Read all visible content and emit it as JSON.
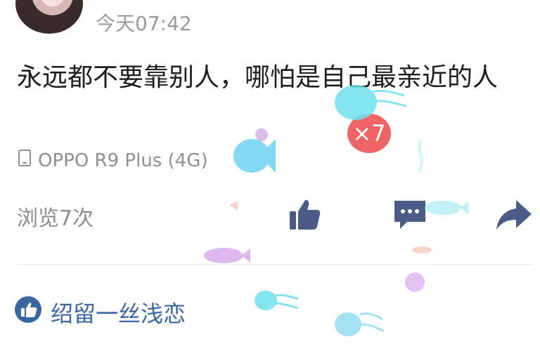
{
  "post": {
    "timestamp": "今天07:42",
    "text": "永远都不要靠别人，哪怕是自己最亲近的人",
    "device": "OPPO R9 Plus (4G)",
    "views": "浏览7次",
    "likers": "绍留一丝浅恋"
  },
  "overlay": {
    "multiplier": "×7"
  },
  "colors": {
    "link_blue": "#3a67a3",
    "icon_blue": "#4a5b85",
    "badge_red": "#ef5c5c"
  },
  "icons": {
    "device": "phone-icon",
    "like": "thumbs-up-icon",
    "comment": "comment-icon",
    "share": "share-icon",
    "liker": "thumbs-up-circle-icon"
  }
}
